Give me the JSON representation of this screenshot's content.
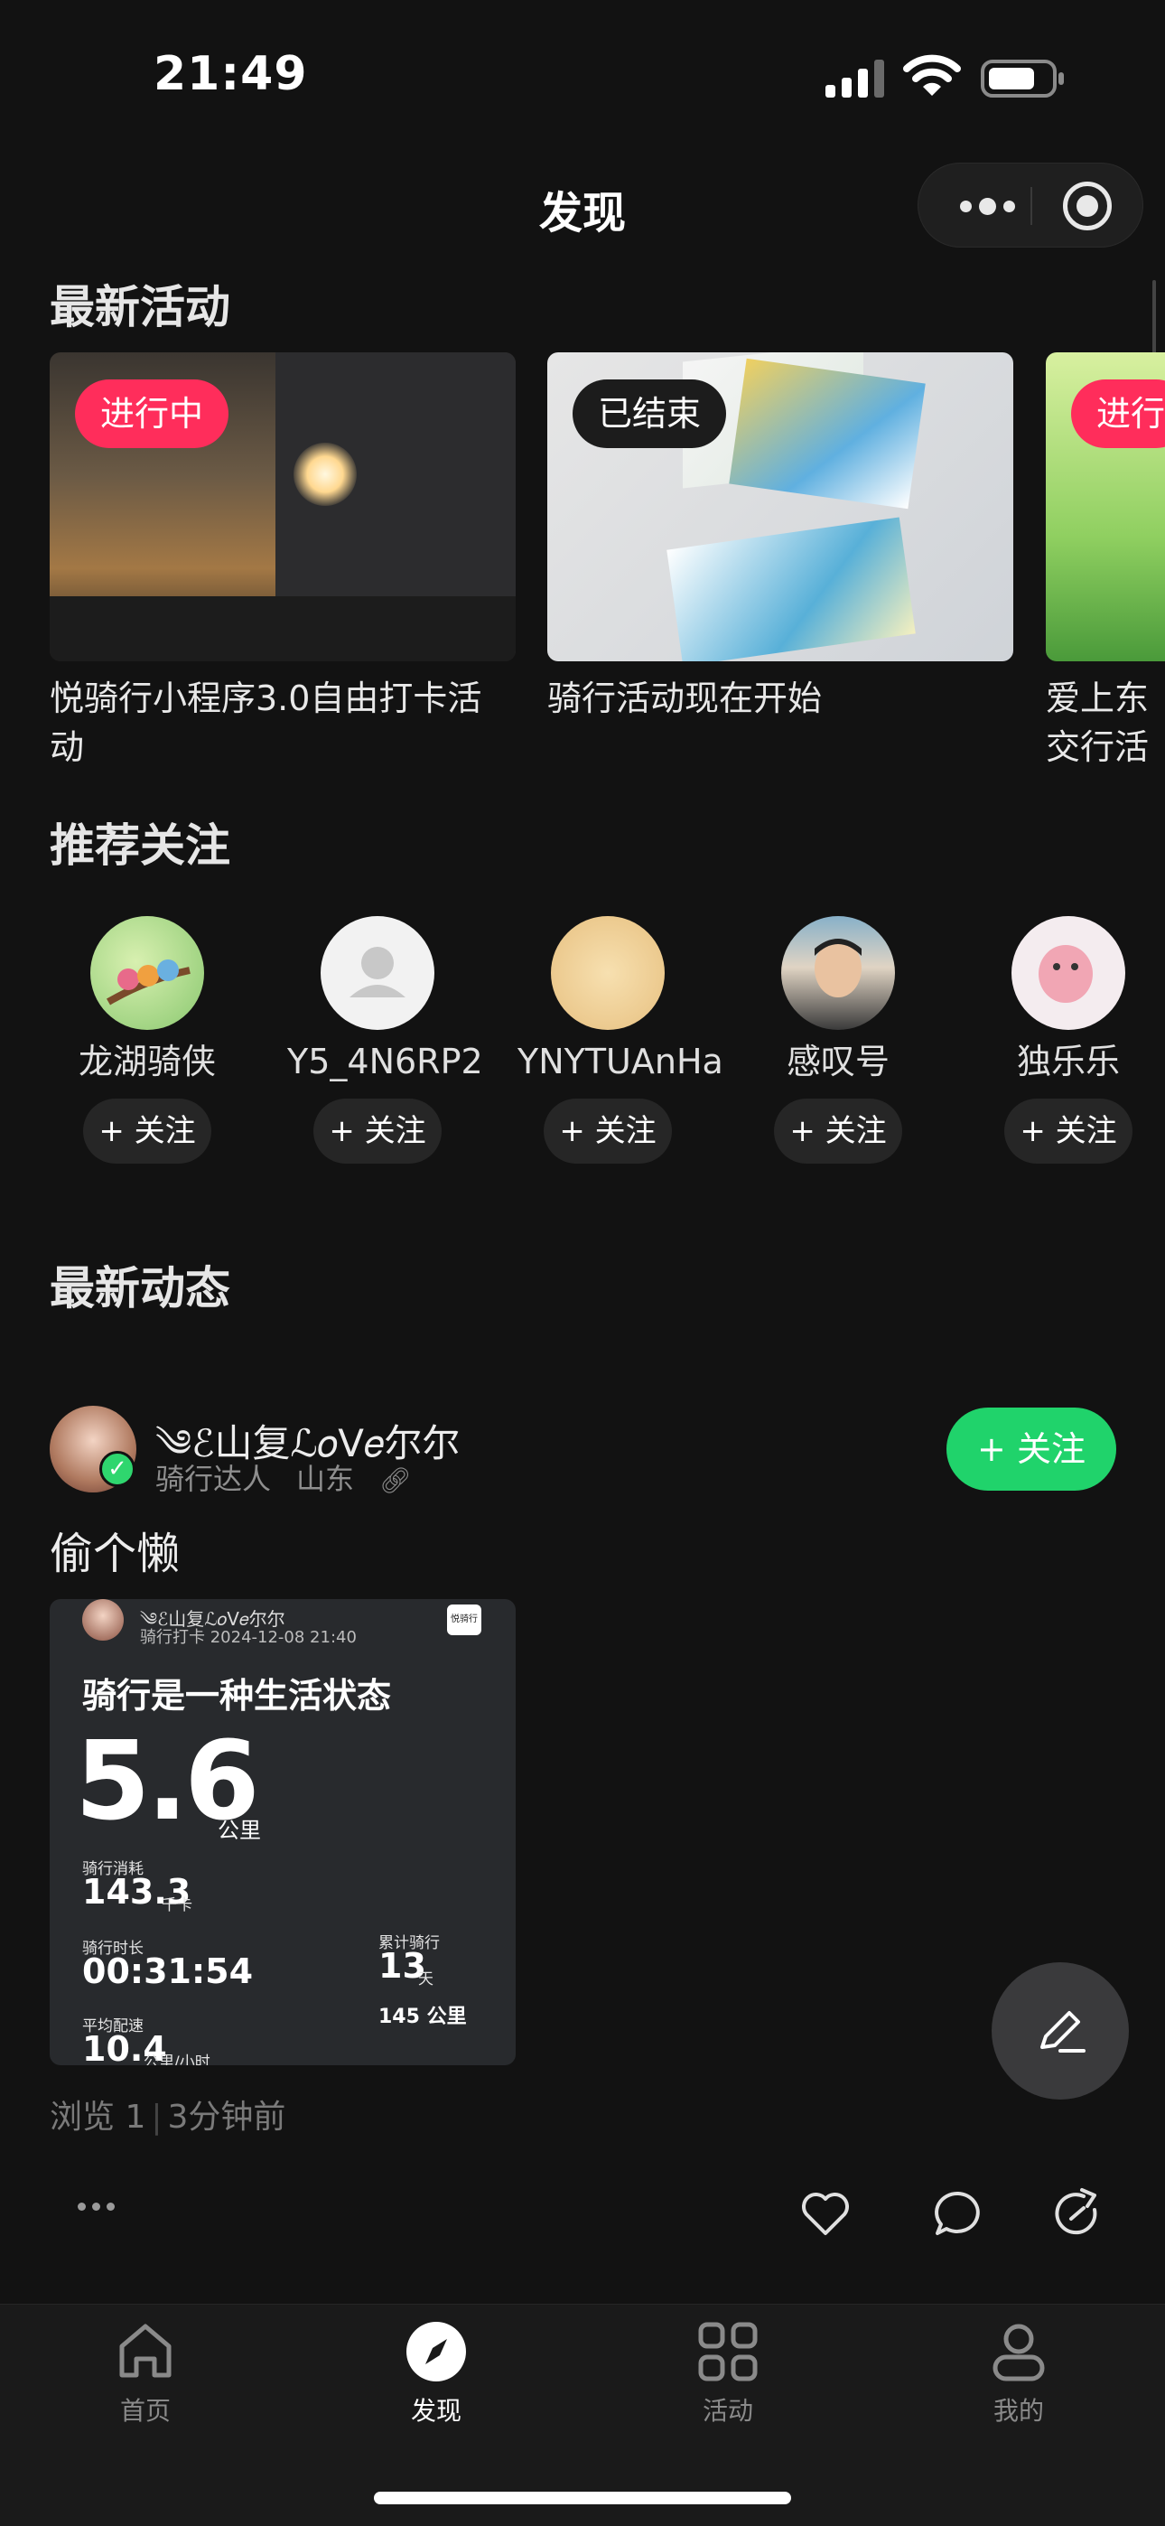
{
  "status_bar": {
    "time": "21:49"
  },
  "header": {
    "title": "发现"
  },
  "sections": {
    "activities_title": "最新活动",
    "recommend_title": "推荐关注",
    "feed_title": "最新动态"
  },
  "activities": [
    {
      "badge": "进行中",
      "title": "悦骑行小程序3.0自由打卡活动"
    },
    {
      "badge": "已结束",
      "title": "骑行活动现在开始"
    },
    {
      "badge": "进行",
      "title": "爱上东交行活动"
    }
  ],
  "recommend_users": [
    {
      "name": "龙湖骑侠",
      "follow": "+ 关注"
    },
    {
      "name": "Y5_4N6RP2",
      "follow": "+ 关注"
    },
    {
      "name": "YNYTUAnHa",
      "follow": "+ 关注"
    },
    {
      "name": "感叹号",
      "follow": "+ 关注"
    },
    {
      "name": "独乐乐",
      "follow": "+ 关注"
    }
  ],
  "post": {
    "author": "༄ℰ山复ℒ𝑜V𝑒尔尔",
    "level": "骑行达人",
    "location": "山东",
    "follow_label": "+ 关注",
    "text": "偷个懒",
    "views": "浏览 1",
    "time_ago": "3分钟前",
    "card": {
      "author": "༄ℰ山复ℒ𝑜V𝑒尔尔",
      "subtitle": "骑行打卡 2024-12-08 21:40",
      "logo": "悦骑行",
      "headline": "骑行是一种生活状态",
      "distance": "5.6",
      "distance_unit": "公里",
      "calories_label": "骑行消耗",
      "calories": "143.3",
      "calories_unit": "千卡",
      "duration_label": "骑行时长",
      "duration": "00:31:54",
      "total_label": "累计骑行",
      "total_days": "13",
      "total_days_unit": "天",
      "total_km": "145 公里",
      "pace_label": "平均配速",
      "pace": "10.4",
      "pace_unit": "公里/小时"
    }
  },
  "tabbar": {
    "home": "首页",
    "discover": "发现",
    "activity": "活动",
    "mine": "我的"
  },
  "colors": {
    "accent_green": "#20d36b",
    "badge_live": "#ff2d5b",
    "background": "#121212"
  }
}
